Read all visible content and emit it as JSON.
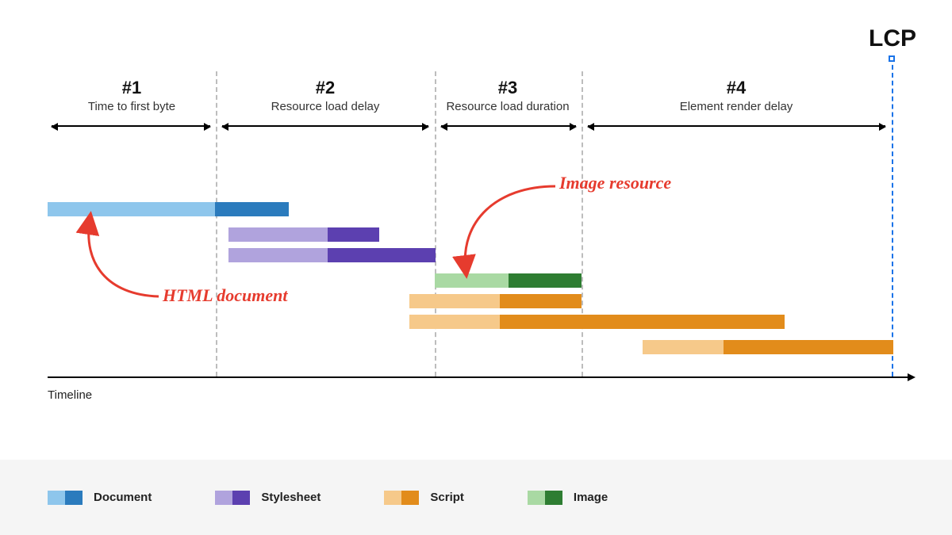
{
  "title": "LCP",
  "axis_label": "Timeline",
  "phases": [
    {
      "num": "#1",
      "label": "Time to first byte"
    },
    {
      "num": "#2",
      "label": "Resource load delay"
    },
    {
      "num": "#3",
      "label": "Resource load duration"
    },
    {
      "num": "#4",
      "label": "Element render delay"
    }
  ],
  "annotations": {
    "html_doc": "HTML document",
    "image_res": "Image resource"
  },
  "legend": [
    {
      "key": "doc",
      "label": "Document"
    },
    {
      "key": "css",
      "label": "Stylesheet"
    },
    {
      "key": "js",
      "label": "Script"
    },
    {
      "key": "img",
      "label": "Image"
    }
  ],
  "chart_data": {
    "type": "gantt",
    "xunit": "timeline-%",
    "phase_boundaries": [
      0,
      19.5,
      45,
      62,
      100
    ],
    "lcp_at": 100,
    "bars": [
      {
        "kind": "doc",
        "start": 0,
        "wait": 19.5,
        "load": 8.5
      },
      {
        "kind": "css",
        "start": 21,
        "wait": 11.5,
        "load": 6
      },
      {
        "kind": "css",
        "start": 21,
        "wait": 11.5,
        "load": 12.5
      },
      {
        "kind": "img",
        "start": 45,
        "wait": 8.5,
        "load": 8.5
      },
      {
        "kind": "js",
        "start": 42,
        "wait": 10.5,
        "load": 9.5
      },
      {
        "kind": "js",
        "start": 42,
        "wait": 10.5,
        "load": 33
      },
      {
        "kind": "js",
        "start": 69,
        "wait": 10,
        "load": 21
      }
    ]
  }
}
